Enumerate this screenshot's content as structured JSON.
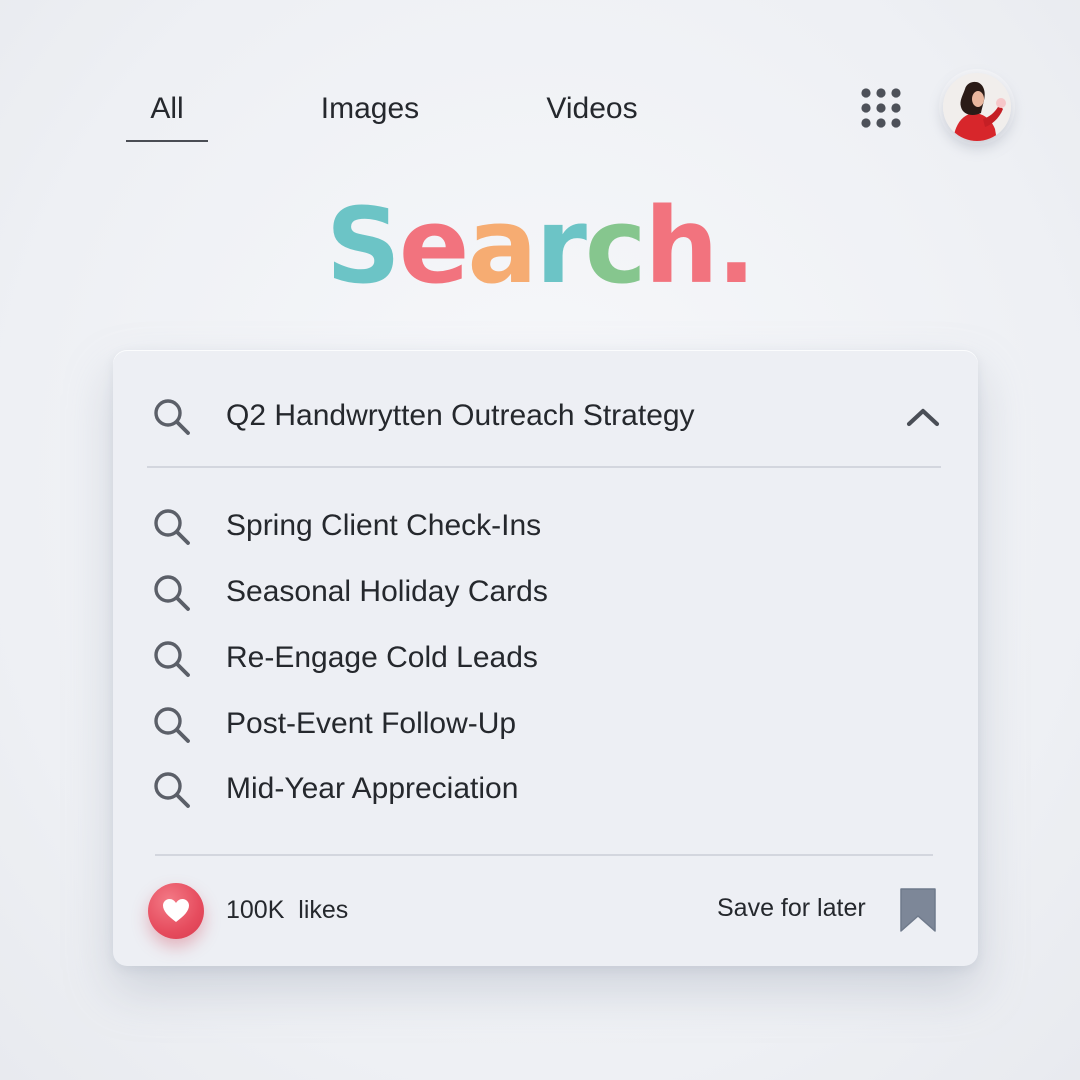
{
  "tabs": [
    {
      "label": "All",
      "active": true
    },
    {
      "label": "Images",
      "active": false
    },
    {
      "label": "Videos",
      "active": false
    }
  ],
  "header": {
    "apps_icon": "apps-grid-icon",
    "avatar_alt": "user-avatar"
  },
  "logo": {
    "letters": [
      "S",
      "e",
      "a",
      "r",
      "c",
      "h",
      "."
    ],
    "colors": [
      "#6cc4c6",
      "#f2737e",
      "#f6ac72",
      "#6cc4c6",
      "#86c68e",
      "#f2737e",
      "#f2737e"
    ]
  },
  "search": {
    "query": "Q2 Handwrytten Outreach Strategy",
    "icon": "search-icon",
    "expanded_icon": "chevron-up-icon",
    "suggestions": [
      "Spring Client Check-Ins",
      "Seasonal Holiday Cards",
      "Re-Engage Cold Leads",
      "Post-Event Follow-Up",
      "Mid-Year Appreciation"
    ]
  },
  "footer": {
    "likes": "100K  likes",
    "like_icon": "heart-icon",
    "save_label": "Save for later",
    "save_icon": "bookmark-icon"
  },
  "colors": {
    "accent_red": "#e64c5e",
    "bookmark": "#7d8798",
    "icon_gray": "#5b5f68",
    "background": "#eef0f4"
  }
}
